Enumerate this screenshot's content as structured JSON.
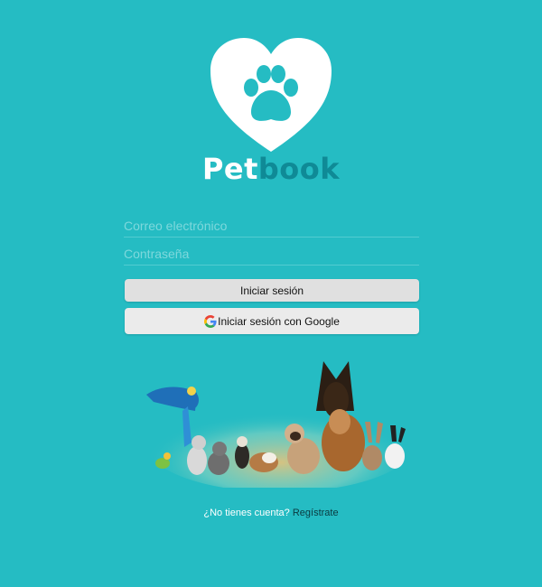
{
  "brand": {
    "pet": "Pet",
    "book": "book"
  },
  "form": {
    "email_placeholder": "Correo electrónico",
    "password_placeholder": "Contraseña",
    "login_label": "Iniciar sesión",
    "google_label": "Iniciar sesión con Google"
  },
  "footer": {
    "question": "¿No tienes cuenta?",
    "register_link": "Regístrate"
  },
  "icons": {
    "logo": "heart-paw-icon",
    "google": "google-g-icon"
  },
  "colors": {
    "background": "#25bcc3",
    "brand_accent": "#0f8a96",
    "button": "#e0e0e0"
  }
}
